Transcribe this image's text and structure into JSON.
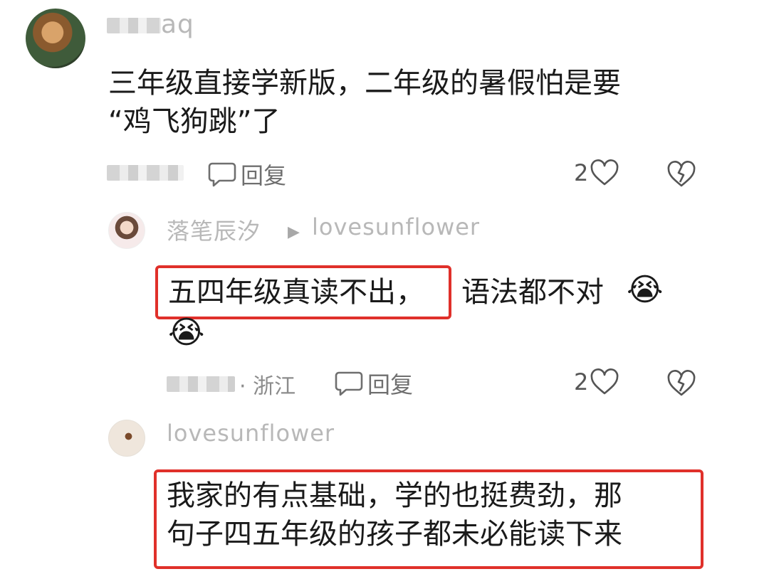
{
  "comments": [
    {
      "username": "aq",
      "content_line1": "三年级直接学新版，二年级的暑假怕是要",
      "content_line2": "“鸡飞狗跳”了",
      "reply_label": "回复",
      "like_count": "2"
    },
    {
      "username": "落笔辰汐",
      "reply_to": "lovesunflower",
      "content_boxed": "五四年级真读不出，",
      "content_rest": "语法都不对",
      "emoji": "😭",
      "location": "· 浙江",
      "reply_label": "回复",
      "like_count": "2"
    },
    {
      "username": "lovesunflower",
      "content_line1": "我家的有点基础，学的也挺费劲，那",
      "content_line2": "句子四五年级的孩子都未必能读下来"
    }
  ],
  "colors": {
    "highlight_border": "#e0302a"
  },
  "icons": [
    "comment-bubble-icon",
    "heart-icon",
    "broken-heart-icon"
  ]
}
